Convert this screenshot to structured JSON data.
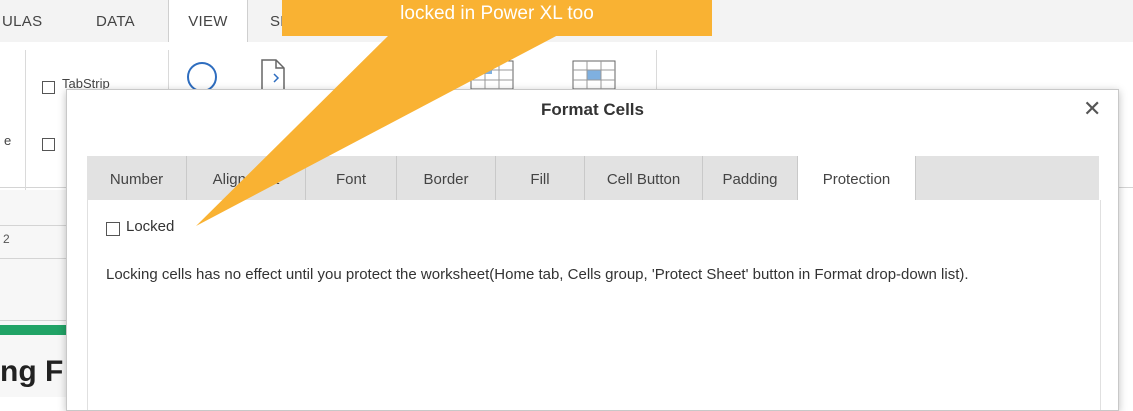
{
  "ribbon": {
    "tabs": [
      "ULAS",
      "DATA",
      "VIEW",
      "SE"
    ],
    "active_tab": "VIEW",
    "checkbox_labels": [
      "TabStrip"
    ],
    "left_fragment": "e"
  },
  "sheet": {
    "row_label": "2",
    "heading_fragment": "ng F",
    "accent_color": "#21a366"
  },
  "dialog": {
    "title": "Format Cells",
    "close_symbol": "✕",
    "tabs": [
      "Number",
      "Alignment",
      "Font",
      "Border",
      "Fill",
      "Cell Button",
      "Padding",
      "Protection"
    ],
    "active_tab": "Protection",
    "locked_label": "Locked",
    "locked_checked": false,
    "description": "Locking cells has no effect until you protect the worksheet(Home tab, Cells group, 'Protect Sheet' button in Format drop-down list)."
  },
  "callout": {
    "text": "locked in Power XL too",
    "color": "#f9b233"
  }
}
